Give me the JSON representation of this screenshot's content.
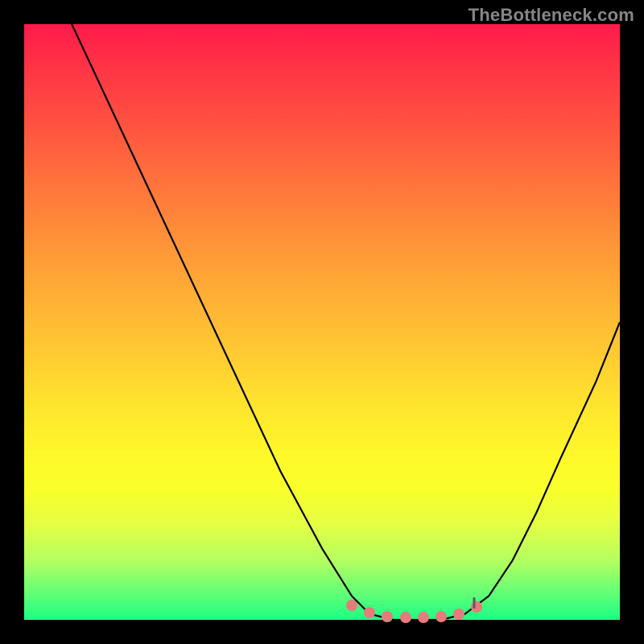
{
  "watermark": "TheBottleneck.com",
  "colors": {
    "dot": "#e77a7a",
    "tick": "#5c5c5c",
    "curve": "#000000"
  },
  "chart_data": {
    "type": "line",
    "title": "",
    "xlabel": "",
    "ylabel": "",
    "xlim": [
      0,
      100
    ],
    "ylim": [
      0,
      100
    ],
    "grid": false,
    "legend": false,
    "series": [
      {
        "name": "v-curve",
        "x": [
          8,
          15,
          22,
          29,
          36,
          43,
          50,
          55,
          58,
          62,
          66,
          70,
          74,
          78,
          82,
          86,
          90,
          96,
          100
        ],
        "y": [
          100,
          85,
          70,
          55,
          40,
          25,
          12,
          4,
          1,
          0,
          0,
          0,
          1,
          4,
          10,
          18,
          27,
          40,
          50
        ]
      }
    ],
    "highlight_points": {
      "name": "bottom-cluster",
      "x": [
        55,
        58,
        61,
        64,
        67,
        70,
        73,
        76
      ],
      "y": [
        2.5,
        1.2,
        0.6,
        0.4,
        0.4,
        0.6,
        1.0,
        2.2
      ]
    },
    "tick_mark": {
      "x": 75.5,
      "y": 2.8
    }
  }
}
